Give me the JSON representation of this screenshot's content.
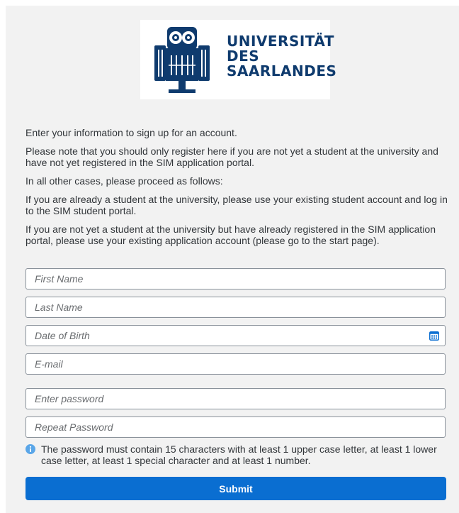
{
  "logo": {
    "line1": "UNIVERSITÄT",
    "line2": "DES",
    "line3": "SAARLANDES",
    "brand_color": "#0f3b6e",
    "icon": "owl-seal-icon"
  },
  "intro": {
    "p1": "Enter your information to sign up for an account.",
    "p2": "Please note that you should only register here if you are not yet a student at the university and have not yet registered in the SIM application portal.",
    "p3": "In all other cases, please proceed as follows:",
    "p4": "If you are already a student at the university, please use your existing student account and log in to the SIM student portal.",
    "p5": "If you are not yet a student at the university but have already registered in the SIM application portal, please use your existing application account (please go to the start page)."
  },
  "form": {
    "first_name": {
      "placeholder": "First Name",
      "value": ""
    },
    "last_name": {
      "placeholder": "Last Name",
      "value": ""
    },
    "dob": {
      "placeholder": "Date of Birth",
      "value": "",
      "icon": "calendar-icon"
    },
    "email": {
      "placeholder": "E-mail",
      "value": ""
    },
    "password": {
      "placeholder": "Enter password",
      "value": ""
    },
    "repeat_password": {
      "placeholder": "Repeat Password",
      "value": ""
    },
    "password_hint": "The password must contain 15 characters with at least 1 upper case letter, at least 1 lower case letter, at least 1 special character and at least 1 number.",
    "hint_icon": "info-icon",
    "submit_label": "Submit"
  },
  "colors": {
    "accent": "#0a6ed1",
    "info": "#5aa6e8"
  }
}
